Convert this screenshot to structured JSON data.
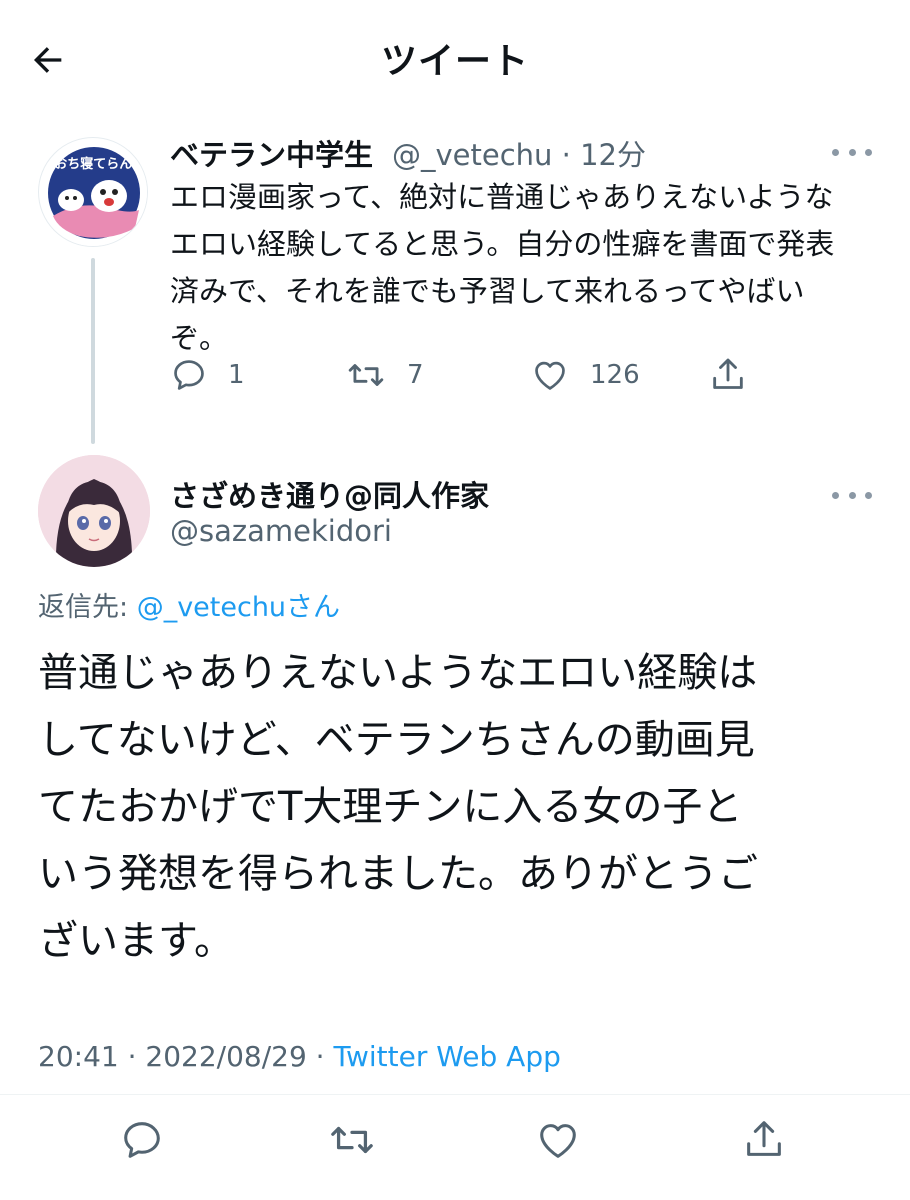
{
  "header": {
    "title": "ツイート"
  },
  "parent_tweet": {
    "display_name": "ベテラン中学生",
    "handle": "@_vetechu",
    "time": "12分",
    "meta": "@_vetechu · 12分",
    "avatar_caption": "おち おち寝てらんない!",
    "text_lines": [
      "エロ漫画家って、絶対に普通じゃありえないような",
      "エロい経験してると思う。自分の性癖を書面で発表",
      "済みで、それを誰でも予習して来れるってやばい",
      "ぞ。"
    ],
    "reply_count": "1",
    "retweet_count": "7",
    "like_count": "126"
  },
  "main_tweet": {
    "display_name": "さざめき通り@同人作家",
    "handle": "@sazamekidori",
    "reply_to_label": "返信先: ",
    "reply_to_handle": "@_vetechuさん",
    "text_lines": [
      "普通じゃありえないようなエロい経験は",
      "してないけど、ベテランちさんの動画見",
      "てたおかげでT大理チンに入る女の子と",
      "いう発想を得られました。ありがとうご",
      "ざいます。"
    ],
    "timestamp": "20:41 · 2022/08/29 · ",
    "source": "Twitter Web App"
  },
  "icons": {
    "back": "arrow-left-icon",
    "more": "more-dots-icon",
    "reply": "reply-bubble-icon",
    "retweet": "retweet-icon",
    "like": "heart-icon",
    "share": "share-icon"
  },
  "colors": {
    "text": "#0f1419",
    "secondary": "#536471",
    "accent": "#1d9bf0",
    "thread_line": "#cfd9de"
  }
}
